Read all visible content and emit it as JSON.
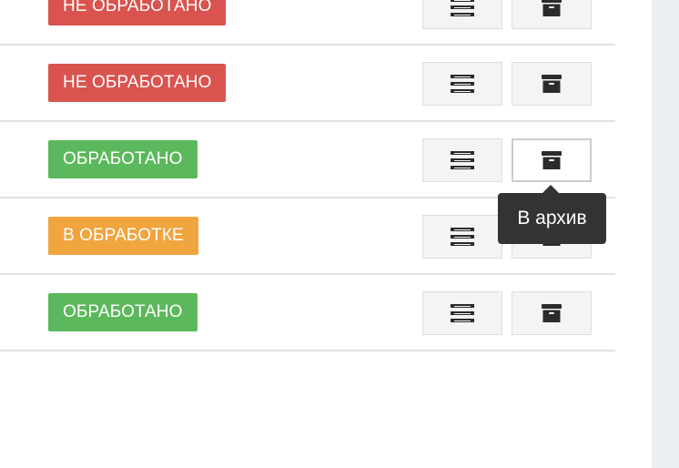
{
  "rows": [
    {
      "status": "НЕ ОБРАБОТАНО",
      "status_color": "#d9534f"
    },
    {
      "status": "НЕ ОБРАБОТАНО",
      "status_color": "#d9534f"
    },
    {
      "status": "ОБРАБОТАНО",
      "status_color": "#5cb85c"
    },
    {
      "status": "В ОБРАБОТКЕ",
      "status_color": "#f0a53f"
    },
    {
      "status": "ОБРАБОТАНО",
      "status_color": "#5cb85c"
    }
  ],
  "icons": {
    "details": "list-details-icon",
    "archive": "archive-box-icon"
  },
  "tooltip": {
    "text": "В архив"
  }
}
